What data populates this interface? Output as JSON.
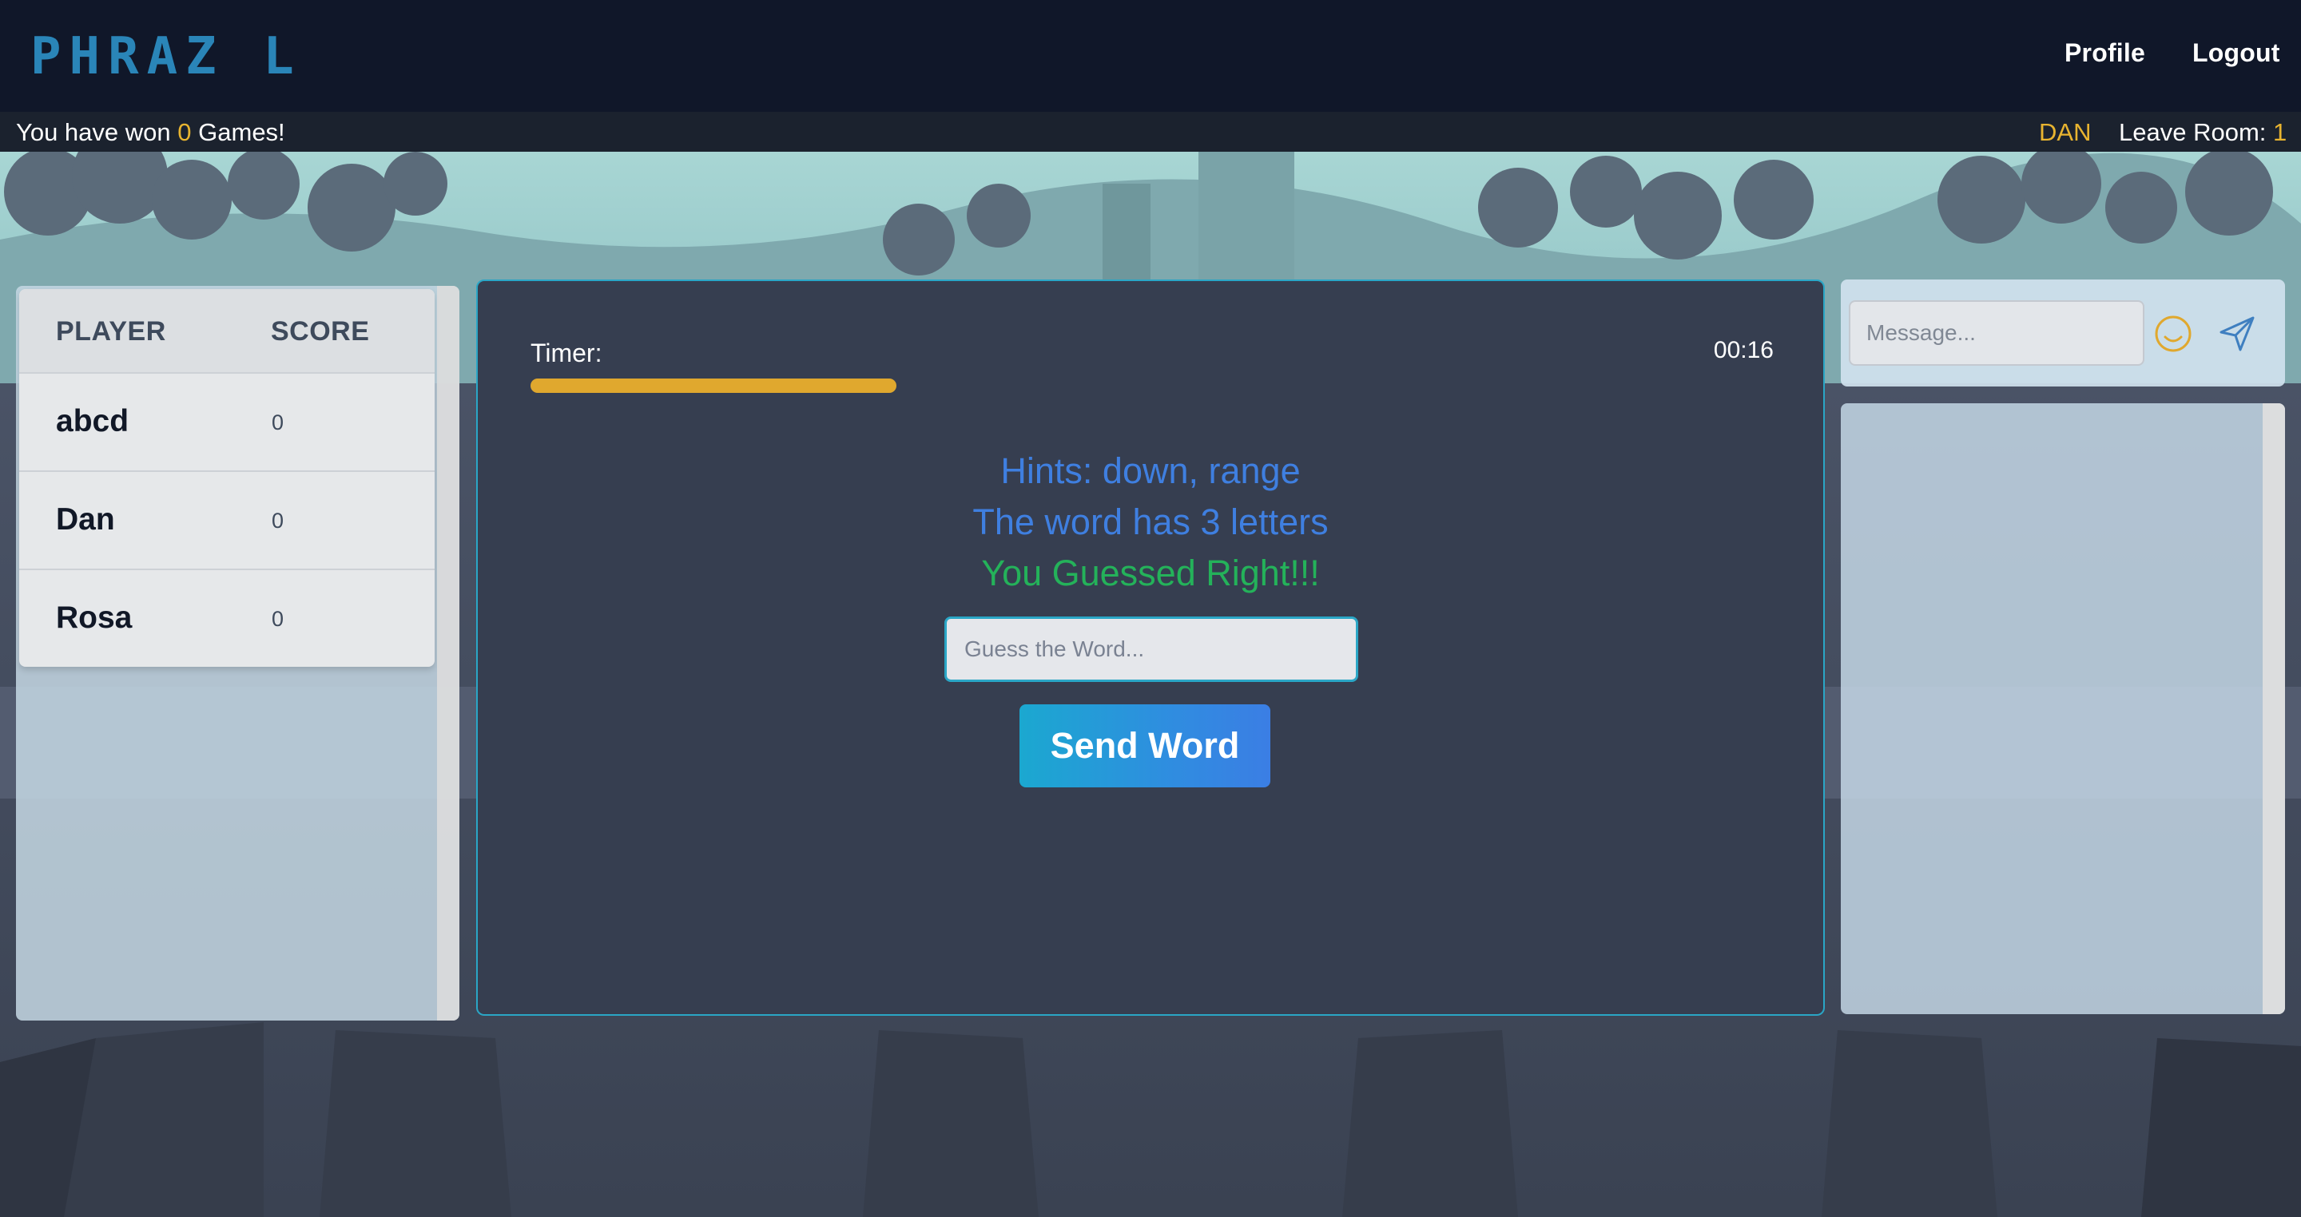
{
  "header": {
    "logo_text": "PHRAZ_L",
    "nav": {
      "profile_label": "Profile",
      "logout_label": "Logout"
    }
  },
  "status_bar": {
    "won_prefix": "You have won",
    "won_count": "0",
    "won_suffix": "Games!",
    "username": "DAN",
    "leave_room_label": "Leave Room:",
    "room_number": "1"
  },
  "scoreboard": {
    "headers": {
      "player": "PLAYER",
      "score": "SCORE"
    },
    "rows": [
      {
        "name": "abcd",
        "score": "0"
      },
      {
        "name": "Dan",
        "score": "0"
      },
      {
        "name": "Rosa",
        "score": "0"
      }
    ]
  },
  "game": {
    "timer_label": "Timer:",
    "timer_value": "00:16",
    "timer_progress_fraction": 0.295,
    "hint_line": "Hints: down, range",
    "letters_line": "The word has 3 letters",
    "result_line": "You Guessed Right!!!",
    "guess_placeholder": "Guess the Word...",
    "send_button_label": "Send Word"
  },
  "chat": {
    "message_placeholder": "Message...",
    "emoji_icon": "smiley-icon",
    "send_icon": "paper-plane-icon"
  },
  "colors": {
    "accent_yellow": "#e8b430",
    "hint_blue": "#3f7fe0",
    "success_green": "#24b25a",
    "panel_border": "#2aa6c6",
    "logo_blue": "#2a85b8"
  }
}
